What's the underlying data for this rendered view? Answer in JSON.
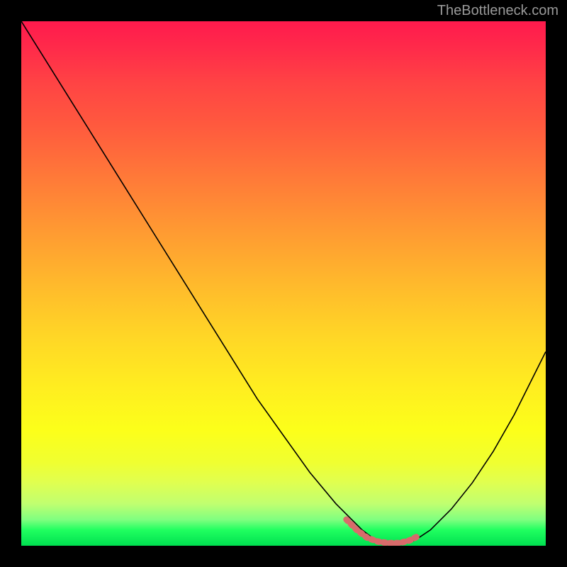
{
  "watermark": "TheBottleneck.com",
  "chart_data": {
    "type": "line",
    "title": "",
    "xlabel": "",
    "ylabel": "",
    "xlim": [
      0,
      100
    ],
    "ylim": [
      0,
      100
    ],
    "grid": false,
    "series": [
      {
        "name": "curve",
        "color": "#000000",
        "x": [
          0,
          5,
          10,
          15,
          20,
          25,
          30,
          35,
          40,
          45,
          50,
          55,
          60,
          65,
          67,
          70,
          73,
          75,
          78,
          82,
          86,
          90,
          94,
          100
        ],
        "y": [
          100,
          92,
          84,
          76,
          68,
          60,
          52,
          44,
          36,
          28,
          21,
          14,
          8,
          3,
          1.5,
          0.5,
          0.5,
          1,
          3,
          7,
          12,
          18,
          25,
          37
        ]
      },
      {
        "name": "highlight",
        "color": "#d86b6b",
        "style": "dashed-thick",
        "x": [
          62,
          64,
          66,
          68,
          70,
          72,
          74,
          76
        ],
        "y": [
          5,
          3,
          1.5,
          0.8,
          0.5,
          0.5,
          1,
          2
        ]
      }
    ],
    "annotations": []
  }
}
